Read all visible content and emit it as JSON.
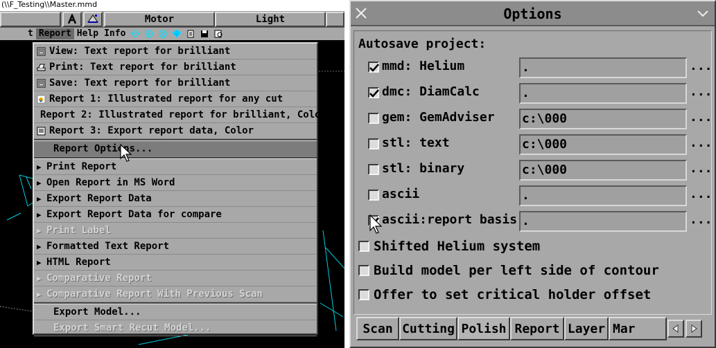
{
  "left": {
    "window_title": "(\\\\F_Testing\\\\Master.mmd",
    "toolbar": {
      "motor_label": "Motor",
      "light_label": "Light"
    },
    "menubar": {
      "items": [
        "t",
        "Report",
        "Help",
        "Info"
      ]
    },
    "report_menu": {
      "items": [
        {
          "label": "View: Text report for brilliant",
          "icon": "view-icon",
          "enabled": true
        },
        {
          "label": "Print: Text report for brilliant",
          "icon": "printer-icon",
          "enabled": true
        },
        {
          "label": "Save: Text report for brilliant",
          "icon": "save-icon",
          "enabled": true
        },
        {
          "label": "Report 1: Illustrated report for any cut",
          "icon": "report-illustrated-icon",
          "enabled": true
        },
        {
          "label": "Report 2: Illustrated report for brilliant, Color",
          "icon": "magnifier-report-icon",
          "enabled": true
        },
        {
          "label": "Report 3: Export report data, Color",
          "icon": "export-data-icon",
          "enabled": true
        },
        {
          "label": "Report Options...",
          "enabled": true
        },
        {
          "label": "Print Report",
          "submenu": true,
          "enabled": true
        },
        {
          "label": "Open Report in MS Word",
          "submenu": true,
          "enabled": true
        },
        {
          "label": "Export Report Data",
          "submenu": true,
          "enabled": true
        },
        {
          "label": "Export Report Data for compare",
          "submenu": true,
          "enabled": true
        },
        {
          "label": "Print Label",
          "submenu": true,
          "enabled": false
        },
        {
          "label": "Formatted Text Report",
          "submenu": true,
          "enabled": true
        },
        {
          "label": "HTML Report",
          "submenu": true,
          "enabled": true
        },
        {
          "label": "Comparative Report",
          "submenu": true,
          "enabled": false
        },
        {
          "label": "Comparative Report With Previous Scan",
          "submenu": true,
          "enabled": false
        },
        {
          "label": "Export Model...",
          "enabled": true
        },
        {
          "label": "Export Smart Recut Model...",
          "enabled": false
        }
      ]
    }
  },
  "options": {
    "title": "Options",
    "section_label": "Autosave project:",
    "autosave_rows": [
      {
        "label": "mmd: Helium",
        "checked": true,
        "path": "."
      },
      {
        "label": "dmc: DiamCalc",
        "checked": true,
        "path": "."
      },
      {
        "label": "gem: GemAdviser",
        "checked": false,
        "path": "c:\\000"
      },
      {
        "label": "stl: text",
        "checked": false,
        "path": "c:\\000"
      },
      {
        "label": "stl: binary",
        "checked": false,
        "path": "c:\\000"
      },
      {
        "label": "ascii",
        "checked": false,
        "path": "."
      },
      {
        "label": "ascii:report basis",
        "checked": true,
        "path": "."
      }
    ],
    "browse_label": "...",
    "extra_options": [
      {
        "label": "Shifted Helium system",
        "checked": false
      },
      {
        "label": "Build model per left side of contour",
        "checked": false
      },
      {
        "label": "Offer to set critical holder offset",
        "checked": false
      }
    ],
    "tabs": [
      "Scan",
      "Cutting",
      "Polish",
      "Report",
      "Layer",
      "Mar"
    ],
    "active_tab": "Polish"
  }
}
